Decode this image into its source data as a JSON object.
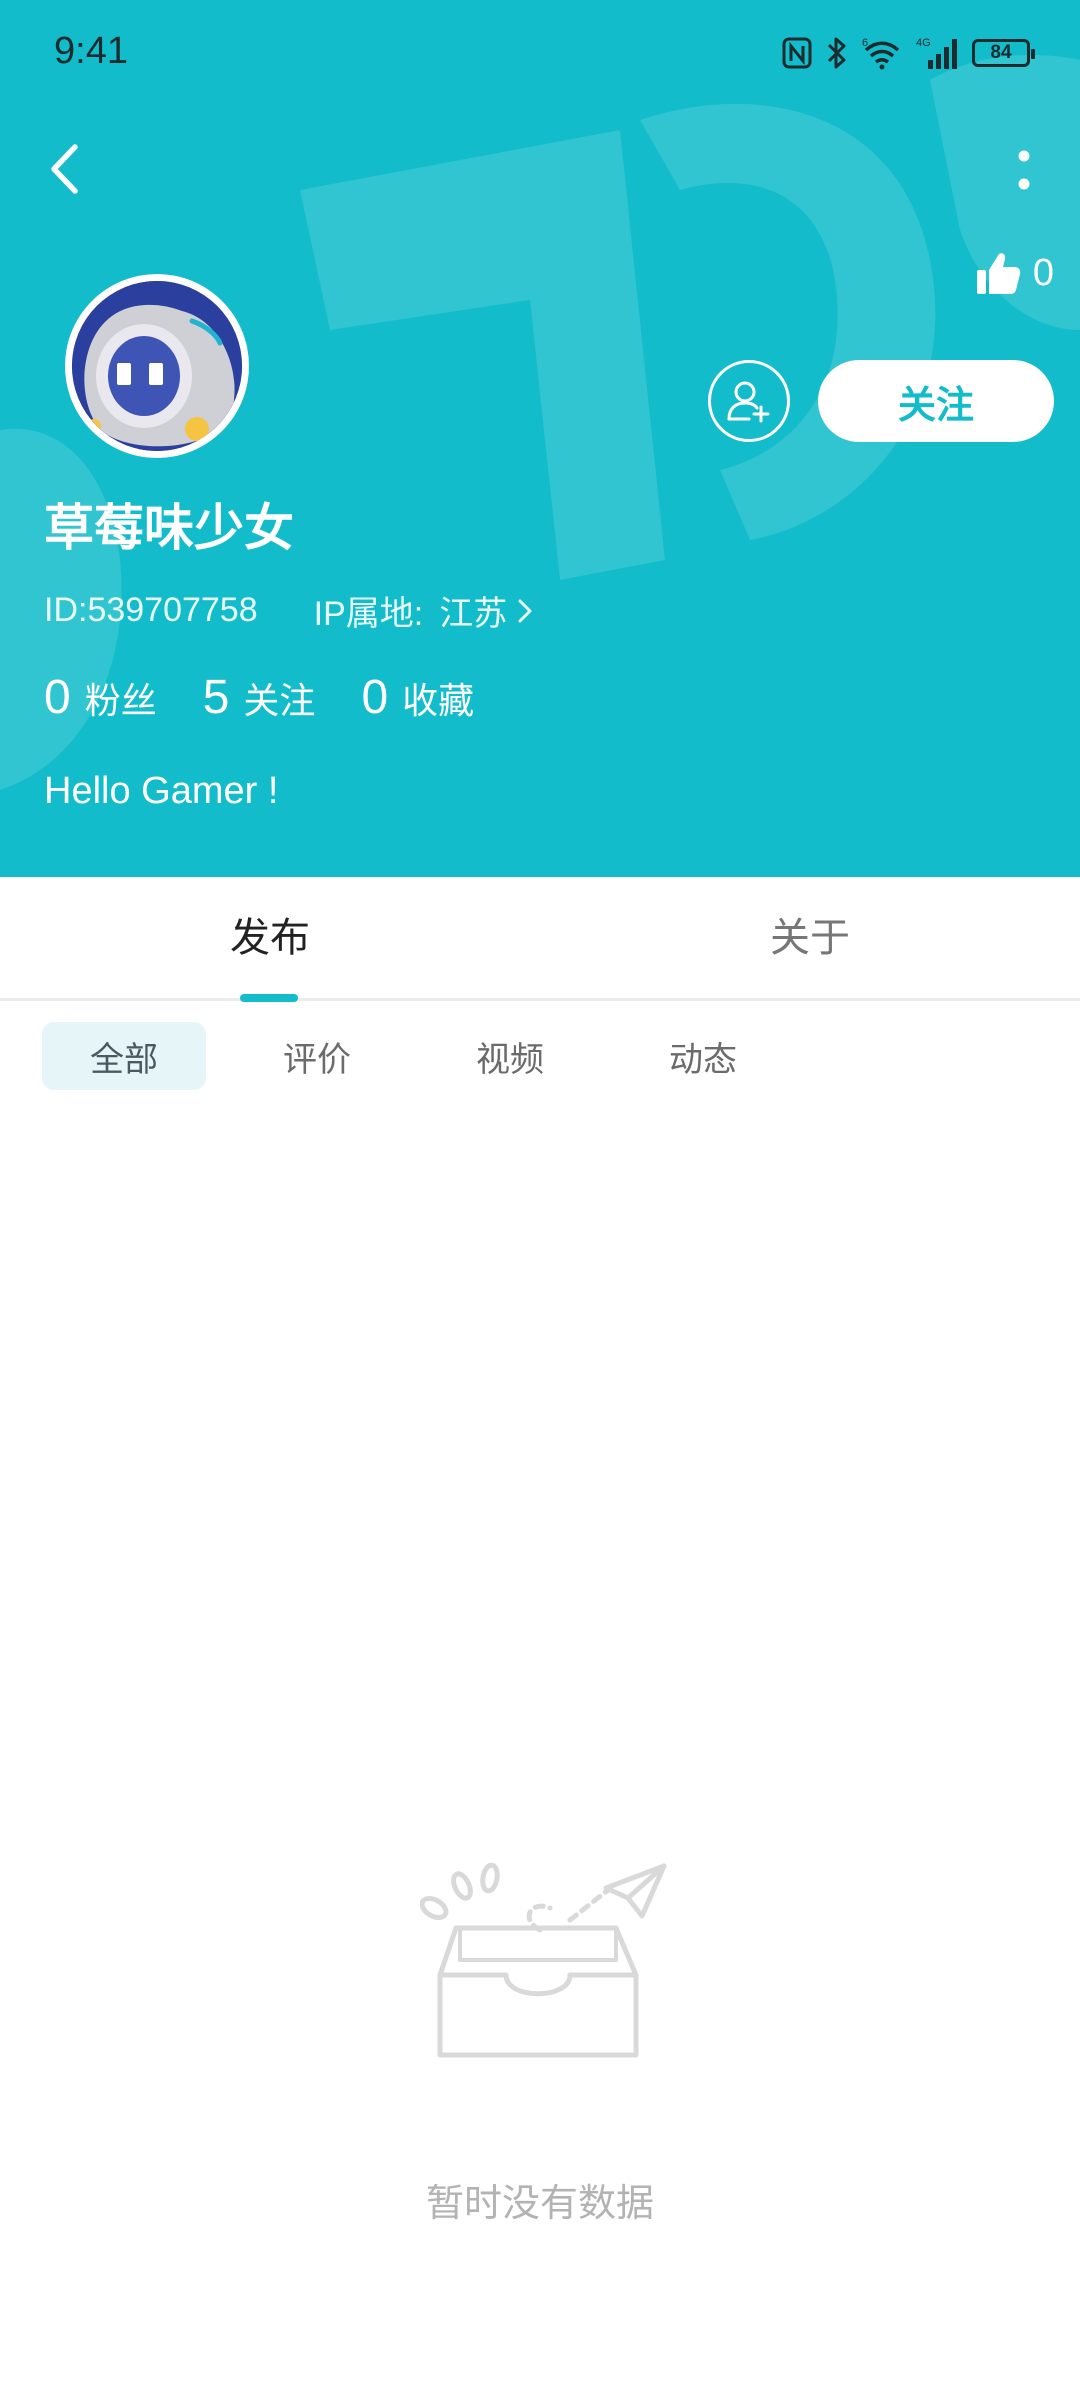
{
  "status_bar": {
    "time": "9:41",
    "battery": "84",
    "network": "4G",
    "wifi_badge": "6"
  },
  "nav": {
    "back_icon": "chevron-left-icon",
    "more_icon": "more-vertical-icon"
  },
  "profile": {
    "like_count": "0",
    "username": "草莓味少女",
    "id_text": "ID:539707758",
    "ip_label": "IP属地:",
    "ip_value": "江苏",
    "stats": [
      {
        "value": "0",
        "label": "粉丝"
      },
      {
        "value": "5",
        "label": "关注"
      },
      {
        "value": "0",
        "label": "收藏"
      }
    ],
    "bio": "Hello Gamer !",
    "follow_label": "关注"
  },
  "tabs": [
    {
      "label": "发布",
      "active": true
    },
    {
      "label": "关于",
      "active": false
    }
  ],
  "filters": [
    {
      "label": "全部",
      "active": true
    },
    {
      "label": "评价",
      "active": false
    },
    {
      "label": "视频",
      "active": false
    },
    {
      "label": "动态",
      "active": false
    }
  ],
  "empty_state": {
    "text": "暂时没有数据"
  },
  "colors": {
    "accent": "#13bccb",
    "chip_active_bg": "#e6f6f8",
    "empty_text": "#b3b3b3"
  }
}
